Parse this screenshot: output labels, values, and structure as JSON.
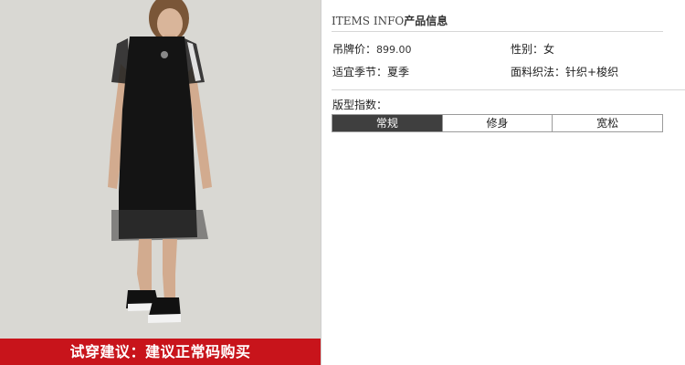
{
  "info": {
    "title_en": "ITEMS INFO",
    "title_cn": "产品信息",
    "price_label": "吊牌价：",
    "price_value": "899.00",
    "gender_label": "性别：",
    "gender_value": "女",
    "season_label": "适宜季节：",
    "season_value": "夏季",
    "fabric_label": "面料织法：",
    "fabric_value": "针织+梭织"
  },
  "fit": {
    "label": "版型指数：",
    "options": [
      "常规",
      "修身",
      "宽松"
    ],
    "selected": "常规"
  },
  "banner": {
    "text": "试穿建议：建议正常码购买",
    "color": "#c8141b"
  },
  "colors": {
    "active_segment": "#3f3f3f",
    "photo_bg": "#d9d8d3"
  }
}
